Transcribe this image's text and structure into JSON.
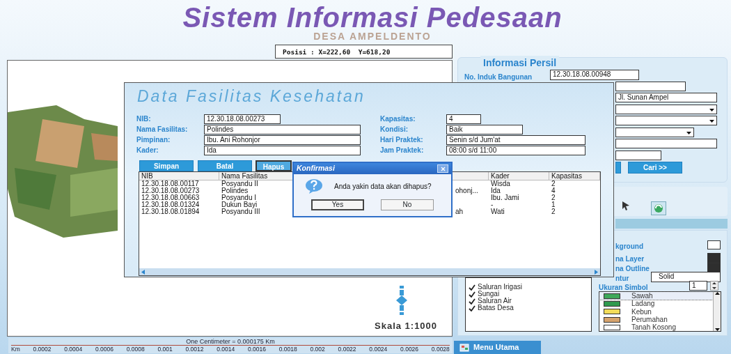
{
  "header": {
    "title": "Sistem Informasi Pedesaan",
    "subtitle": "DESA AMPELDENTO",
    "position": "Posisi : X=222,60  Y=618,20"
  },
  "map": {
    "scale": "Skala 1:1000",
    "scale_bar": {
      "caption": "One Centimeter = 0.000175 Km",
      "unit": "Km",
      "ticks": [
        "0.0002",
        "0.0004",
        "0.0006",
        "0.0008",
        "0.001",
        "0.0012",
        "0.0014",
        "0.0016",
        "0.0018",
        "0.002",
        "0.0022",
        "0.0024",
        "0.0026",
        "0.0028"
      ]
    }
  },
  "persil_panel": {
    "title": "Informasi Persil",
    "label": "No. Induk Bangunan",
    "nib": "12.30.18.08.00948",
    "fields": [
      {
        "kind": "text"
      },
      {
        "kind": "text",
        "value": "Jl. Sunan Ampel"
      },
      {
        "kind": "select"
      },
      {
        "kind": "select"
      },
      {
        "kind": "select"
      },
      {
        "kind": "text"
      },
      {
        "kind": "text"
      }
    ],
    "search_button": "Cari >>"
  },
  "symbol_panel": {
    "rows": [
      {
        "kind": "color",
        "label": "kground",
        "color": "#ffffff"
      },
      {
        "kind": "color",
        "label": "na Layer",
        "color": "#2e2e2e"
      },
      {
        "kind": "color",
        "label": "na Outline",
        "color": "#2e2e2e"
      },
      {
        "kind": "select",
        "label": "ntur",
        "value": "Solid"
      }
    ],
    "size_label": "Ukuran Simbol",
    "size_value": "1",
    "legend": [
      {
        "label": "Sawah",
        "color": "#3fa85a",
        "selected": true
      },
      {
        "label": "Ladang",
        "color": "#2f9a4e",
        "selected": false
      },
      {
        "label": "Kebun",
        "color": "#f2dc5a",
        "selected": false
      },
      {
        "label": "Perumahan",
        "color": "#d6a36c",
        "selected": false
      },
      {
        "label": "Tanah Kosong",
        "color": "#ffffff",
        "selected": false
      }
    ]
  },
  "layers": [
    {
      "label": "Saluran Irigasi",
      "checked": true
    },
    {
      "label": "Sungai",
      "checked": true
    },
    {
      "label": "Saluran Air",
      "checked": true
    },
    {
      "label": "Batas Desa",
      "checked": true
    }
  ],
  "menu_button": "Menu Utama",
  "facility_window": {
    "title": "Data Fasilitas Kesehatan",
    "fields_left": [
      {
        "label": "NIB:",
        "value": "12.30.18.08.00273",
        "kind": "short"
      },
      {
        "label": "Nama Fasilitas:",
        "value": "Polindes",
        "kind": "long"
      },
      {
        "label": "Pimpinan:",
        "value": "Ibu. Ani Rohonjor",
        "kind": "long"
      },
      {
        "label": "Kader:",
        "value": "Ida",
        "kind": "long"
      }
    ],
    "fields_right": [
      {
        "label": "Kapasitas:",
        "value": "4",
        "kind": "short"
      },
      {
        "label": "Kondisi:",
        "value": "Baik",
        "kind": "medium"
      },
      {
        "label": "Hari Praktek:",
        "value": "Senin s/d Jum'at",
        "kind": "long"
      },
      {
        "label": "Jam Praktek:",
        "value": "08:00 s/d 11:00",
        "kind": "long"
      }
    ],
    "buttons": [
      {
        "label": "Simpan",
        "focused": false
      },
      {
        "label": "Batal",
        "focused": false
      },
      {
        "label": "Hapus",
        "focused": true
      }
    ],
    "table": {
      "columns": [
        "NIB",
        "Nama Fasilitas",
        null,
        "Kader",
        "Kapasitas"
      ],
      "rows": [
        [
          "12.30.18.08.00117",
          "Posyandu II",
          null,
          "Wisda",
          "2"
        ],
        [
          "12.30.18.08.00273",
          "Polindes",
          "ohonj...",
          "Ida",
          "4"
        ],
        [
          "12.30.18.08.00663",
          "Posyandu I",
          null,
          "Ibu. Jami",
          "2"
        ],
        [
          "12.30.18.08.01324",
          "Dukun Bayi",
          null,
          "-",
          "1"
        ],
        [
          "12.30.18.08.01894",
          "Posyandu III",
          "ah",
          "Wati",
          "2"
        ]
      ]
    }
  },
  "confirm_dialog": {
    "title": "Konfirmasi",
    "message": "Anda yakin data akan dihapus?",
    "buttons": [
      {
        "label": "Yes",
        "focused": true
      },
      {
        "label": "No",
        "focused": false
      }
    ]
  }
}
